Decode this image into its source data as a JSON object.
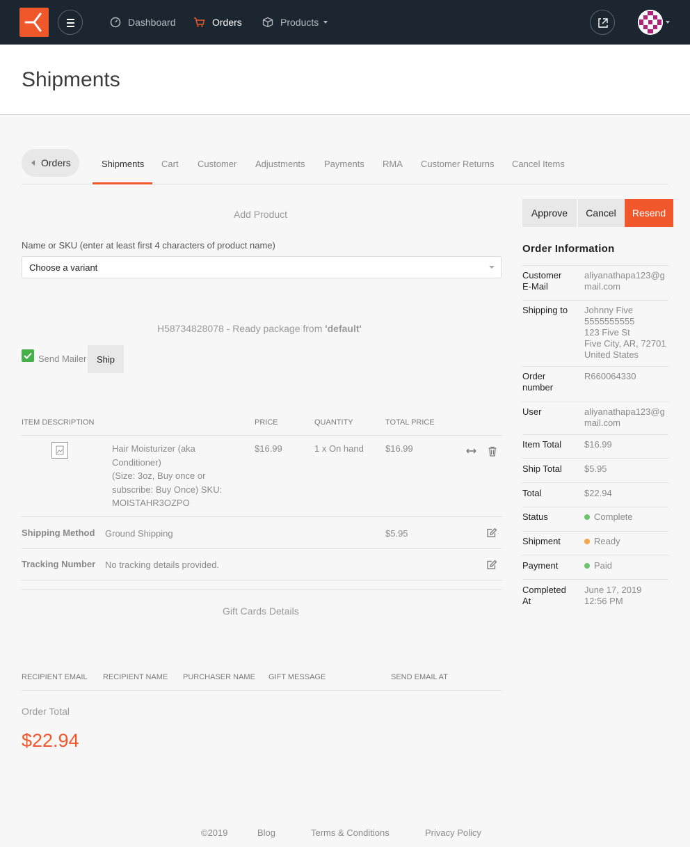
{
  "nav": {
    "items": [
      {
        "label": "Dashboard",
        "icon": "dashboard-icon"
      },
      {
        "label": "Orders",
        "icon": "cart-icon"
      },
      {
        "label": "Products",
        "icon": "box-icon"
      }
    ]
  },
  "header": {
    "title": "Shipments"
  },
  "tabs": {
    "back_label": "Orders",
    "items": [
      "Shipments",
      "Cart",
      "Customer",
      "Adjustments",
      "Payments",
      "RMA",
      "Customer Returns",
      "Cancel Items"
    ]
  },
  "add_product": {
    "title": "Add Product",
    "field_label": "Name or SKU (enter at least first 4 characters of product name)",
    "select_value": "Choose a variant"
  },
  "shipment": {
    "heading_prefix": "H58734828078 - Ready package from ",
    "heading_location": "'default'",
    "send_mailer_label": "Send Mailer",
    "send_mailer_checked": true,
    "ship_label": "Ship"
  },
  "table": {
    "headers": [
      "ITEM DESCRIPTION",
      "PRICE",
      "QUANTITY",
      "TOTAL PRICE"
    ],
    "item": {
      "name_line1": "Hair Moisturizer (aka",
      "name_line2": "Conditioner)",
      "name_line3": "(Size: 3oz, Buy once or",
      "name_line4": "subscribe: Buy Once) SKU:",
      "name_line5": "MOISTAHR3OZPO",
      "price": "$16.99",
      "quantity": "1 x On hand",
      "total": "$16.99"
    },
    "shipping_method": {
      "label": "Shipping Method",
      "value": "Ground Shipping",
      "cost": "$5.95"
    },
    "tracking": {
      "label": "Tracking Number",
      "value": "No tracking details provided."
    }
  },
  "gift_cards": {
    "title": "Gift Cards Details",
    "headers": [
      "RECIPIENT EMAIL",
      "RECIPIENT NAME",
      "PURCHASER NAME",
      "GIFT MESSAGE",
      "SEND EMAIL AT"
    ]
  },
  "order_total": {
    "label": "Order Total",
    "value": "$22.94"
  },
  "actions": {
    "approve": "Approve",
    "cancel": "Cancel",
    "resend": "Resend"
  },
  "order_info": {
    "title": "Order Information",
    "customer_email_label_1": "Customer",
    "customer_email_label_2": "E-Mail",
    "customer_email": "aliyanathapa123@gmail.com",
    "shipping_to_label": "Shipping to",
    "ship_name": "Johnny Five",
    "ship_phone": "5555555555",
    "ship_street": "123 Five St",
    "ship_city": "Five City, AR, 72701",
    "ship_country": "United States",
    "order_number_label_1": "Order",
    "order_number_label_2": "number",
    "order_number": "R660064330",
    "user_label": "User",
    "user": "aliyanathapa123@gmail.com",
    "item_total_label": "Item Total",
    "item_total": "$16.99",
    "ship_total_label": "Ship Total",
    "ship_total": "$5.95",
    "total_label": "Total",
    "total": "$22.94",
    "status_label": "Status",
    "status": "Complete",
    "shipment_label": "Shipment",
    "shipment": "Ready",
    "payment_label": "Payment",
    "payment": "Paid",
    "completed_label_1": "Completed",
    "completed_label_2": "At",
    "completed_date": "June 17, 2019",
    "completed_time": "12:56 PM"
  },
  "colors": {
    "accent": "#f0582b",
    "green": "#6cc36e",
    "orange": "#f5a64a",
    "nav_bg": "#1b2631"
  },
  "footer": {
    "copyright": "©2019",
    "blog": "Blog",
    "terms": "Terms & Conditions",
    "privacy": "Privacy Policy"
  }
}
